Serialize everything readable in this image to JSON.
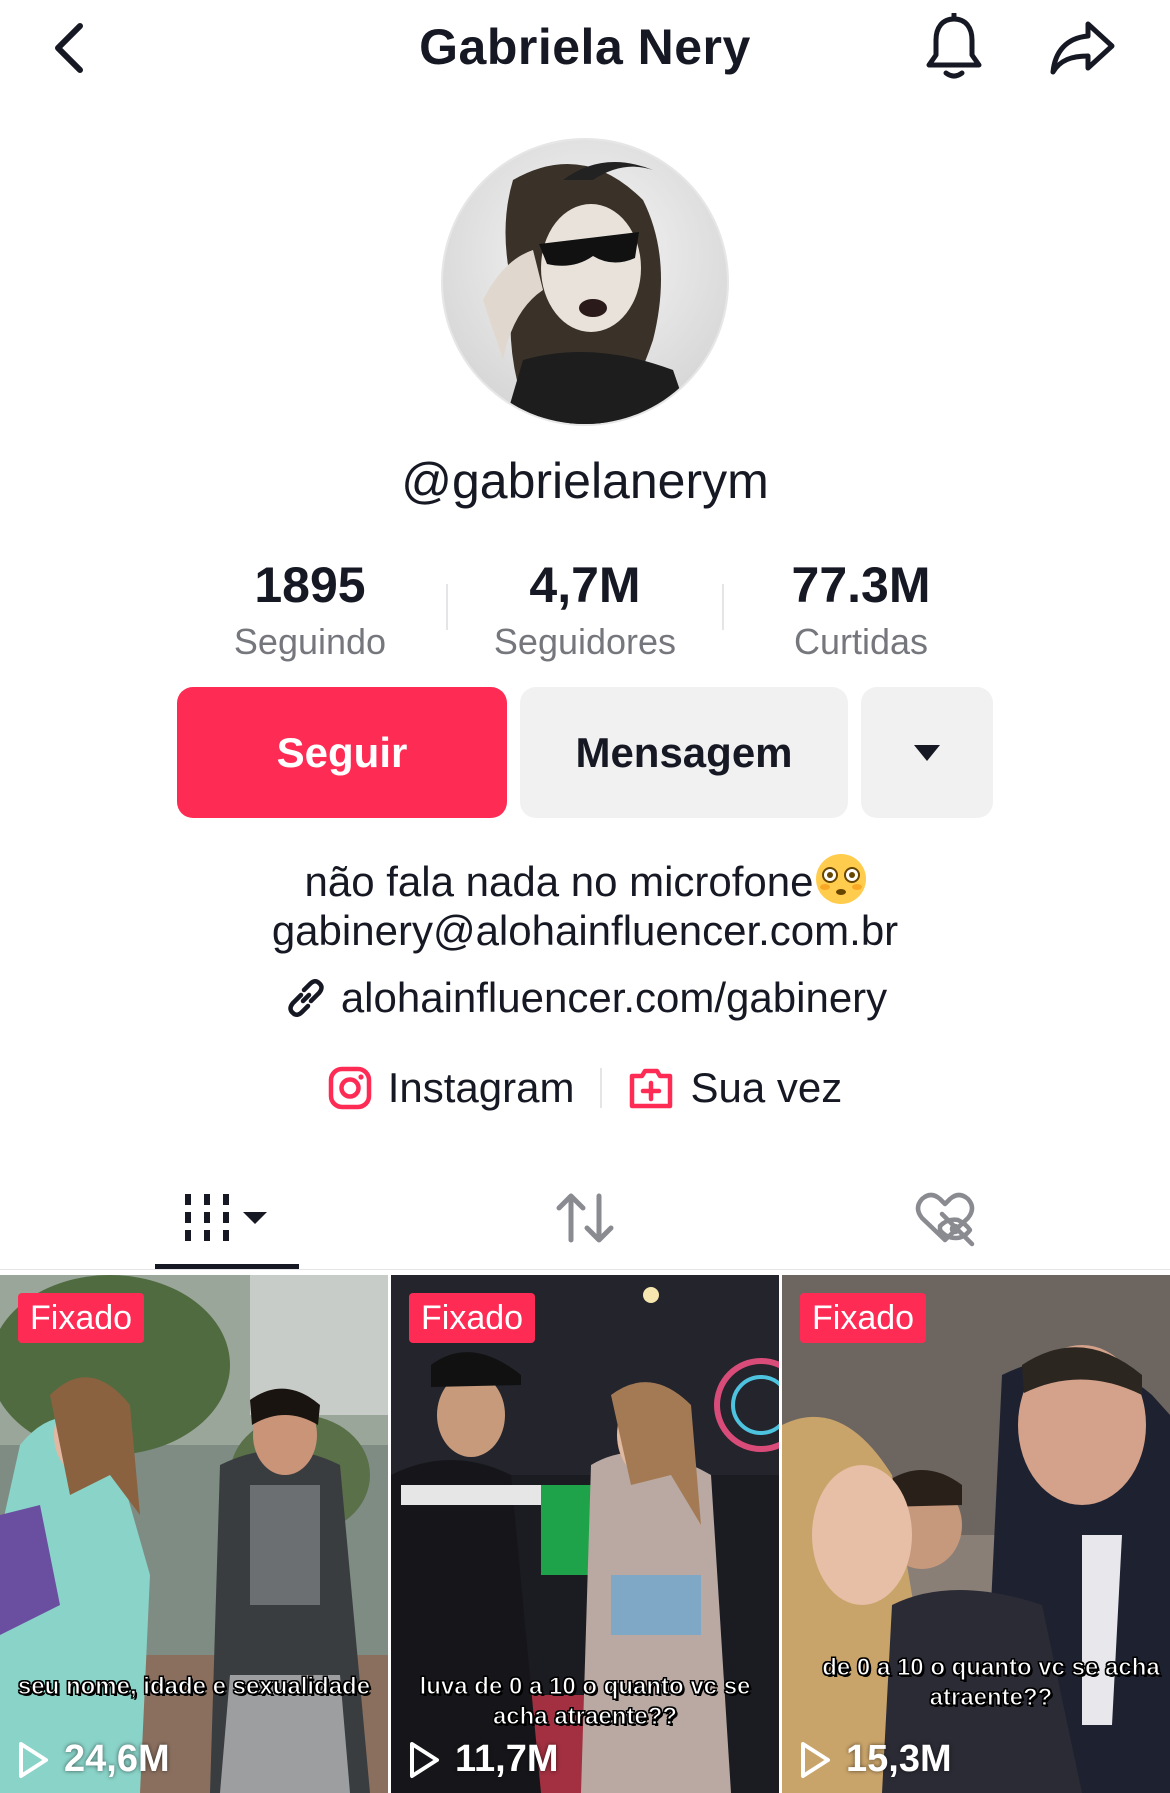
{
  "header": {
    "title": "Gabriela Nery"
  },
  "profile": {
    "username": "@gabrielanerym",
    "stats": [
      {
        "value": "1895",
        "label": "Seguindo"
      },
      {
        "value": "4,7M",
        "label": "Seguidores"
      },
      {
        "value": "77.3M",
        "label": "Curtidas"
      }
    ],
    "follow_label": "Seguir",
    "message_label": "Mensagem",
    "bio_line1": "não fala nada no microfone",
    "bio_emoji": "flushed-face",
    "bio_email": "gabinery@alohainfluencer.com.br",
    "link": "alohainfluencer.com/gabinery"
  },
  "social": {
    "instagram_label": "Instagram",
    "suavez_label": "Sua vez"
  },
  "tabs": [
    {
      "name": "videos",
      "icon": "grid-columns-icon",
      "active": true
    },
    {
      "name": "reposts",
      "icon": "repost-icon",
      "active": false
    },
    {
      "name": "liked",
      "icon": "hidden-heart-icon",
      "active": false
    }
  ],
  "videos": [
    {
      "pinned_label": "Fixado",
      "caption": "seu nome, idade e sexualidade",
      "views": "24,6M"
    },
    {
      "pinned_label": "Fixado",
      "caption": "luva de 0 a 10 o quanto vc se acha atraente??",
      "views": "11,7M"
    },
    {
      "pinned_label": "Fixado",
      "caption": "de 0 a 10 o quanto vc se acha atraente??",
      "views": "15,3M"
    }
  ],
  "colors": {
    "accent": "#fe2c55",
    "text": "#161823",
    "muted": "#75777d",
    "button_gray": "#f1f1f2"
  }
}
